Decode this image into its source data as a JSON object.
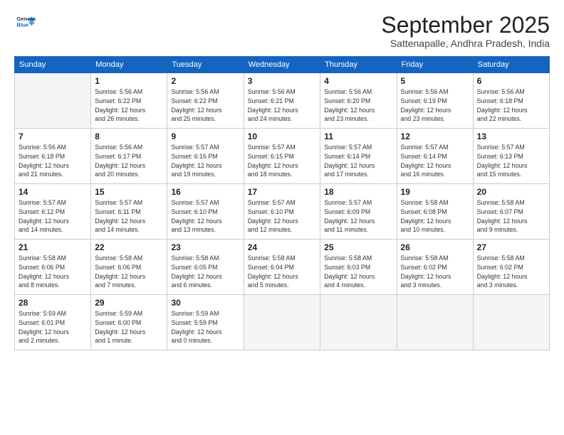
{
  "logo": {
    "general": "General",
    "blue": "Blue"
  },
  "header": {
    "month": "September 2025",
    "location": "Sattenapalle, Andhra Pradesh, India"
  },
  "weekdays": [
    "Sunday",
    "Monday",
    "Tuesday",
    "Wednesday",
    "Thursday",
    "Friday",
    "Saturday"
  ],
  "weeks": [
    [
      {
        "day": "",
        "info": ""
      },
      {
        "day": "1",
        "info": "Sunrise: 5:56 AM\nSunset: 6:22 PM\nDaylight: 12 hours\nand 26 minutes."
      },
      {
        "day": "2",
        "info": "Sunrise: 5:56 AM\nSunset: 6:22 PM\nDaylight: 12 hours\nand 25 minutes."
      },
      {
        "day": "3",
        "info": "Sunrise: 5:56 AM\nSunset: 6:21 PM\nDaylight: 12 hours\nand 24 minutes."
      },
      {
        "day": "4",
        "info": "Sunrise: 5:56 AM\nSunset: 6:20 PM\nDaylight: 12 hours\nand 23 minutes."
      },
      {
        "day": "5",
        "info": "Sunrise: 5:56 AM\nSunset: 6:19 PM\nDaylight: 12 hours\nand 23 minutes."
      },
      {
        "day": "6",
        "info": "Sunrise: 5:56 AM\nSunset: 6:18 PM\nDaylight: 12 hours\nand 22 minutes."
      }
    ],
    [
      {
        "day": "7",
        "info": "Sunrise: 5:56 AM\nSunset: 6:18 PM\nDaylight: 12 hours\nand 21 minutes."
      },
      {
        "day": "8",
        "info": "Sunrise: 5:56 AM\nSunset: 6:17 PM\nDaylight: 12 hours\nand 20 minutes."
      },
      {
        "day": "9",
        "info": "Sunrise: 5:57 AM\nSunset: 6:16 PM\nDaylight: 12 hours\nand 19 minutes."
      },
      {
        "day": "10",
        "info": "Sunrise: 5:57 AM\nSunset: 6:15 PM\nDaylight: 12 hours\nand 18 minutes."
      },
      {
        "day": "11",
        "info": "Sunrise: 5:57 AM\nSunset: 6:14 PM\nDaylight: 12 hours\nand 17 minutes."
      },
      {
        "day": "12",
        "info": "Sunrise: 5:57 AM\nSunset: 6:14 PM\nDaylight: 12 hours\nand 16 minutes."
      },
      {
        "day": "13",
        "info": "Sunrise: 5:57 AM\nSunset: 6:13 PM\nDaylight: 12 hours\nand 15 minutes."
      }
    ],
    [
      {
        "day": "14",
        "info": "Sunrise: 5:57 AM\nSunset: 6:12 PM\nDaylight: 12 hours\nand 14 minutes."
      },
      {
        "day": "15",
        "info": "Sunrise: 5:57 AM\nSunset: 6:11 PM\nDaylight: 12 hours\nand 14 minutes."
      },
      {
        "day": "16",
        "info": "Sunrise: 5:57 AM\nSunset: 6:10 PM\nDaylight: 12 hours\nand 13 minutes."
      },
      {
        "day": "17",
        "info": "Sunrise: 5:57 AM\nSunset: 6:10 PM\nDaylight: 12 hours\nand 12 minutes."
      },
      {
        "day": "18",
        "info": "Sunrise: 5:57 AM\nSunset: 6:09 PM\nDaylight: 12 hours\nand 11 minutes."
      },
      {
        "day": "19",
        "info": "Sunrise: 5:58 AM\nSunset: 6:08 PM\nDaylight: 12 hours\nand 10 minutes."
      },
      {
        "day": "20",
        "info": "Sunrise: 5:58 AM\nSunset: 6:07 PM\nDaylight: 12 hours\nand 9 minutes."
      }
    ],
    [
      {
        "day": "21",
        "info": "Sunrise: 5:58 AM\nSunset: 6:06 PM\nDaylight: 12 hours\nand 8 minutes."
      },
      {
        "day": "22",
        "info": "Sunrise: 5:58 AM\nSunset: 6:06 PM\nDaylight: 12 hours\nand 7 minutes."
      },
      {
        "day": "23",
        "info": "Sunrise: 5:58 AM\nSunset: 6:05 PM\nDaylight: 12 hours\nand 6 minutes."
      },
      {
        "day": "24",
        "info": "Sunrise: 5:58 AM\nSunset: 6:04 PM\nDaylight: 12 hours\nand 5 minutes."
      },
      {
        "day": "25",
        "info": "Sunrise: 5:58 AM\nSunset: 6:03 PM\nDaylight: 12 hours\nand 4 minutes."
      },
      {
        "day": "26",
        "info": "Sunrise: 5:58 AM\nSunset: 6:02 PM\nDaylight: 12 hours\nand 3 minutes."
      },
      {
        "day": "27",
        "info": "Sunrise: 5:58 AM\nSunset: 6:02 PM\nDaylight: 12 hours\nand 3 minutes."
      }
    ],
    [
      {
        "day": "28",
        "info": "Sunrise: 5:59 AM\nSunset: 6:01 PM\nDaylight: 12 hours\nand 2 minutes."
      },
      {
        "day": "29",
        "info": "Sunrise: 5:59 AM\nSunset: 6:00 PM\nDaylight: 12 hours\nand 1 minute."
      },
      {
        "day": "30",
        "info": "Sunrise: 5:59 AM\nSunset: 5:59 PM\nDaylight: 12 hours\nand 0 minutes."
      },
      {
        "day": "",
        "info": ""
      },
      {
        "day": "",
        "info": ""
      },
      {
        "day": "",
        "info": ""
      },
      {
        "day": "",
        "info": ""
      }
    ]
  ]
}
